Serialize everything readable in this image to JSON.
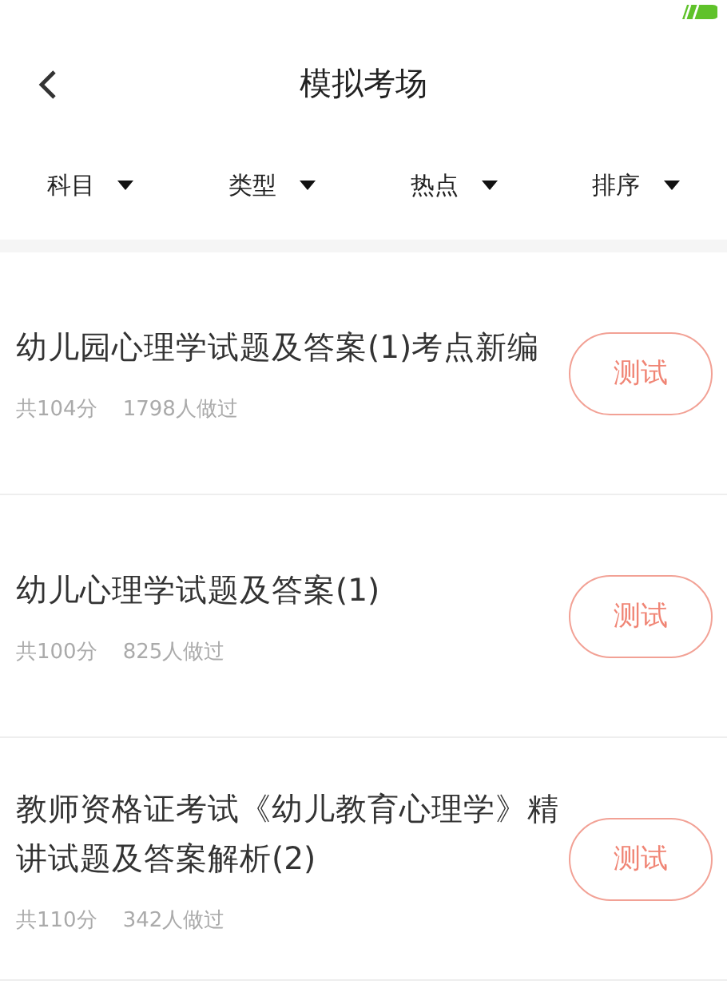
{
  "header": {
    "title": "模拟考场"
  },
  "filters": [
    {
      "label": "科目"
    },
    {
      "label": "类型"
    },
    {
      "label": "热点"
    },
    {
      "label": "排序"
    }
  ],
  "exams": [
    {
      "title": "幼儿园心理学试题及答案(1)考点新编",
      "score": "共104分",
      "takers": "1798人做过",
      "button": "测试"
    },
    {
      "title": "幼儿心理学试题及答案(1)",
      "score": "共100分",
      "takers": "825人做过",
      "button": "测试"
    },
    {
      "title": "教师资格证考试《幼儿教育心理学》精讲试题及答案解析(2)",
      "score": "共110分",
      "takers": "342人做过",
      "button": "测试"
    }
  ]
}
